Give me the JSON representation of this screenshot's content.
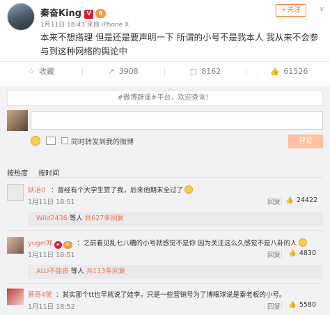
{
  "post": {
    "author": "秦奋King",
    "verified_badge": "V",
    "level_badge": "6",
    "time": "1月11日 18:43",
    "source_prefix": "来自",
    "source": "iPhone X",
    "follow_label": "+关注",
    "text": "本来不想搭理 但是还是要声明一下 所谓的小号不是我本人 我从来不会参与到这种网络的舆论中"
  },
  "actions": {
    "favorite": "收藏",
    "repost": "3908",
    "comment": "8162",
    "like": "61526"
  },
  "notice": "#微博辟谣#平台，欢迎查询！",
  "composer": {
    "repost_label": "同时转发到我的微博",
    "submit_label": "评论"
  },
  "sort": {
    "heat": "按热度",
    "time": "按时间"
  },
  "comments": [
    {
      "name": "妖冶0",
      "text": "：曾经有个大学生赞了我，后来他期末全过了",
      "time": "1月11日 18:51",
      "reply": "回复",
      "likes": "24422",
      "sub": {
        "name": "Wild2436",
        "rest": " 等人 ",
        "count": "共627条回复"
      }
    },
    {
      "name": "yugel郑",
      "text": "：之前看见乱七八糟的小号就感觉不是你 因为关注这么久感觉不是八卦的人",
      "time": "1月11日 18:51",
      "reply": "回复",
      "likes": "4830",
      "sub": {
        "name": "ALU不能丧",
        "rest": " 等人 ",
        "count": "共113条回复"
      }
    },
    {
      "name": "蔡哥4號",
      "text": "：其实那个tt也早就说了娃李，只是一些营销号为了博眼球说是秦老板的小号。",
      "time": "1月11日 18:52",
      "reply": "回复",
      "likes": "5580"
    }
  ]
}
